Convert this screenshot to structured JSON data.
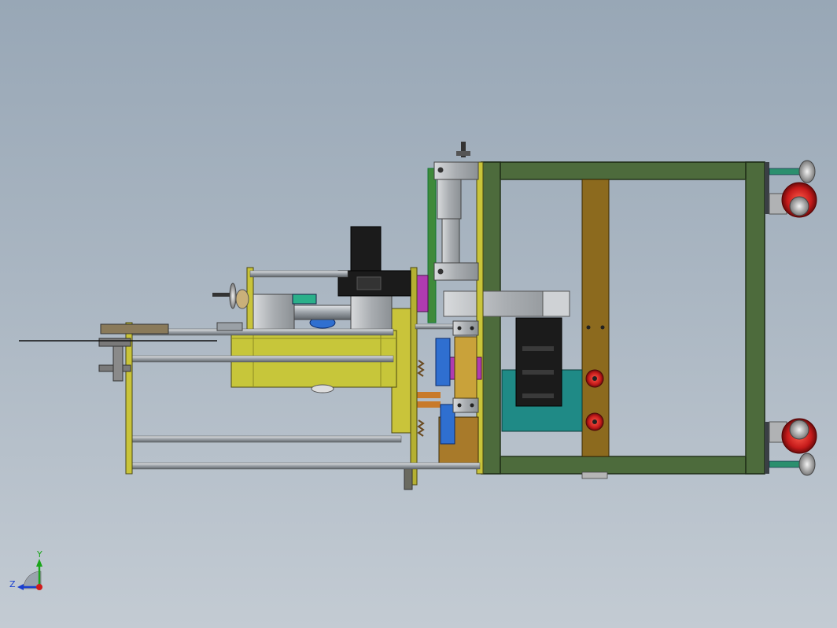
{
  "viewport": {
    "background_top": "#98a7b6",
    "background_bottom": "#c3cbd3"
  },
  "colors": {
    "frame_green": "#4d6b3c",
    "plate_yellow": "#c9c43a",
    "block_yellow": "#c7c63a",
    "beam_brown": "#8c6a1e",
    "motor_black": "#1b1b1b",
    "motor_teal": "#1f8a86",
    "accent_magenta": "#b03bb0",
    "accent_blue": "#2f6fd0",
    "wheel_red": "#c41a1a",
    "rod_grey": "#9aa0a6",
    "bracket_grey": "#b9bcc0"
  },
  "triad": {
    "y_label": "Y",
    "z_label": "Z",
    "y_color": "#1aa51a",
    "z_color": "#1a3fd0",
    "x_color": "#d01a1a"
  }
}
